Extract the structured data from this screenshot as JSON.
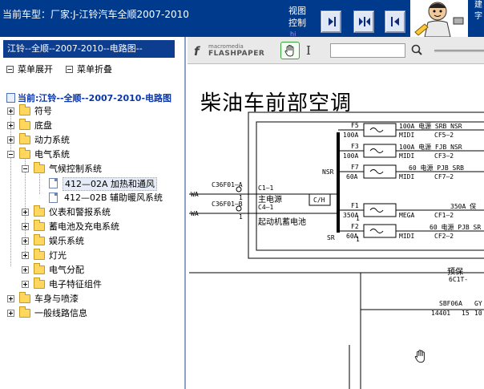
{
  "header": {
    "car_model_title": "当前车型：厂家:J-江铃汽车全顺2007-2010",
    "view_control_label": "视图控制",
    "view_control_sub": "hi",
    "right_edge_text": "建字",
    "nav_buttons": [
      "step-in",
      "split",
      "step-back"
    ]
  },
  "sidebar": {
    "crumb": "江铃--全顺--2007-2010--电路图--",
    "expand_all": "菜单展开",
    "collapse_all": "菜单折叠",
    "current": "当前:江铃--全顺--2007-2010-电路图",
    "tree": [
      {
        "label": "符号",
        "state": "collapsed",
        "level": 0
      },
      {
        "label": "底盘",
        "state": "collapsed",
        "level": 0
      },
      {
        "label": "动力系统",
        "state": "collapsed",
        "level": 0
      },
      {
        "label": "电气系统",
        "state": "expanded",
        "level": 0
      },
      {
        "label": "气候控制系统",
        "state": "expanded",
        "level": 1
      },
      {
        "label": "412—02A 加热和通风",
        "state": "selected",
        "level": 2
      },
      {
        "label": "412—02B 辅助暖风系统",
        "state": "leaf",
        "level": 2
      },
      {
        "label": "仪表和警报系统",
        "state": "collapsed",
        "level": 1
      },
      {
        "label": "蓄电池及充电系统",
        "state": "collapsed",
        "level": 1
      },
      {
        "label": "娱乐系统",
        "state": "collapsed",
        "level": 1
      },
      {
        "label": "灯光",
        "state": "collapsed",
        "level": 1
      },
      {
        "label": "电气分配",
        "state": "collapsed",
        "level": 1
      },
      {
        "label": "电子特征组件",
        "state": "collapsed",
        "level": 1
      },
      {
        "label": "车身与喷漆",
        "state": "collapsed",
        "level": 0
      },
      {
        "label": "一般线路信息",
        "state": "collapsed",
        "level": 0
      }
    ]
  },
  "viewer": {
    "brand_small": "macromedia",
    "brand_big": "FLASHPAPER",
    "search_placeholder": "",
    "diagram": {
      "title": "柴油车前部空调",
      "fuses": [
        {
          "id": "F5",
          "rating": "100A",
          "desc": "100A_电源_SRB_NSR",
          "circuit": "CF5—2"
        },
        {
          "id": "F3",
          "rating": "100A",
          "desc": "100A_电源_FJB_NSR",
          "circuit": "CF3—2"
        },
        {
          "id": "F7",
          "rating": "60A",
          "desc": "60_电源_PJB_SRB",
          "circuit": "CF7—2"
        },
        {
          "id": "F1",
          "rating": "350A",
          "desc": "350A_保",
          "circuit": "CF1—2"
        },
        {
          "id": "F2",
          "rating": "60A",
          "desc": "60_电源_PJB_SR",
          "circuit": "CF2—2"
        }
      ],
      "labels": {
        "nsr": "NSR",
        "sr": "SR",
        "midi": "MIDI",
        "mega": "MEGA",
        "ch": "C/H",
        "main_power": "主电源",
        "start_battery": "起动机蓄电池",
        "c1_1": "C1—1",
        "c4_1": "C4—1",
        "wa1": "WA",
        "wa2": "WA",
        "conn1": "C36F01—A",
        "conn2": "C36F01—B",
        "pin1": "1",
        "pin2": "1",
        "fuse_num1": "1",
        "fuse_num2": "1",
        "preserve": "预保",
        "code_6c1": "6C1T-",
        "sbf": "SBF06A",
        "gy": "GY",
        "num_14401": "14401",
        "num_15": "15",
        "num_10": "10"
      }
    }
  }
}
